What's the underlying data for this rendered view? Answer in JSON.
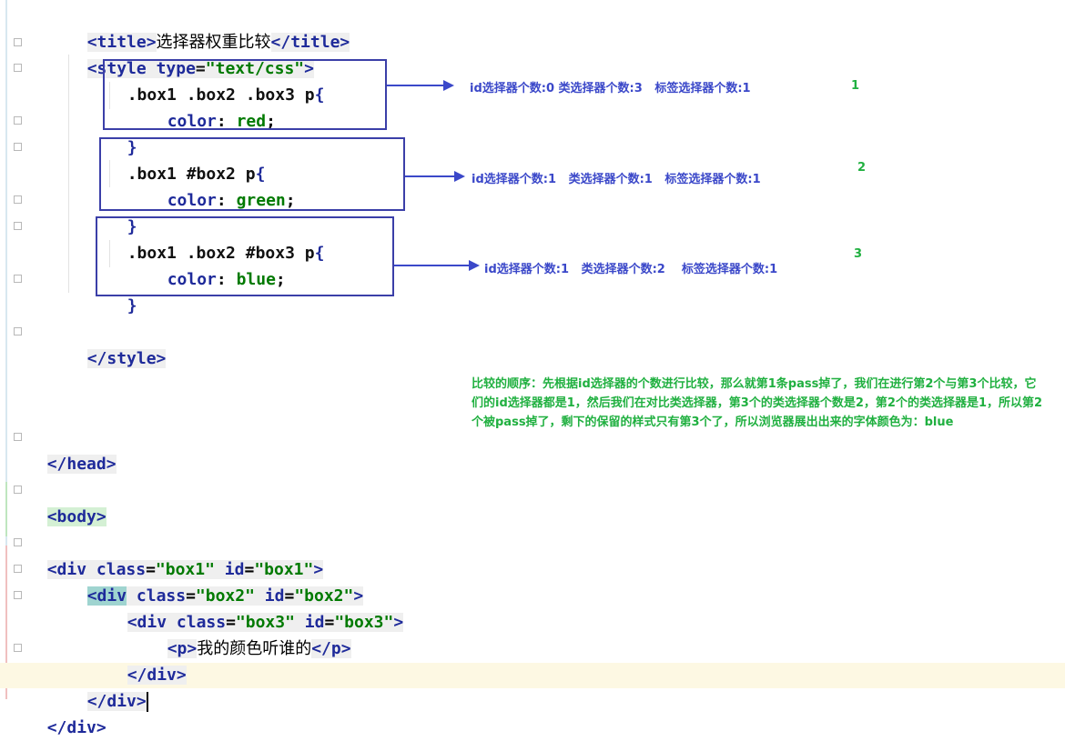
{
  "editor": {
    "lines": {
      "title": {
        "open_tag": "<title>",
        "text": "选择器权重比较",
        "close_tag": "</title>"
      },
      "style_open": {
        "tag_start": "<style",
        "attr": "type",
        "eq": "=",
        "value": "\"text/css\"",
        "tag_end": ">"
      },
      "rule1": {
        "selector": ".box1 .box2 .box3 p",
        "brace_open": "{",
        "property": "color",
        "colon": ": ",
        "value": "red",
        "semi": ";",
        "brace_close": "}"
      },
      "rule2": {
        "selector": ".box1 #box2 p",
        "brace_open": "{",
        "property": "color",
        "colon": ": ",
        "value": "green",
        "semi": ";",
        "brace_close": "}"
      },
      "rule3": {
        "selector": ".box1 .box2 #box3 p",
        "brace_open": "{",
        "property": "color",
        "colon": ": ",
        "value": "blue",
        "semi": ";",
        "brace_close": "}"
      },
      "style_close": "</style>",
      "head_close": "</head>",
      "body_open": "<body>",
      "div1": {
        "tag_start": "<div",
        "class_attr": "class",
        "class_val": "\"box1\"",
        "id_attr": "id",
        "id_val": "\"box1\"",
        "tag_end": ">"
      },
      "div2": {
        "tag_start": "<div",
        "class_attr": "class",
        "class_val": "\"box2\"",
        "id_attr": "id",
        "id_val": "\"box2\"",
        "tag_end": ">"
      },
      "div3": {
        "tag_start": "<div",
        "class_attr": "class",
        "class_val": "\"box3\"",
        "id_attr": "id",
        "id_val": "\"box3\"",
        "tag_end": ">"
      },
      "p_line": {
        "open_tag": "<p>",
        "text": "我的颜色听谁的",
        "close_tag": "</p>"
      },
      "div3_close": "</div>",
      "div2_close": "</div>",
      "div1_close_partial": "</div>"
    }
  },
  "annotations": {
    "note1": "id选择器个数:0 类选择器个数:3   标签选择器个数:1",
    "note2": "id选择器个数:1   类选择器个数:1   标签选择器个数:1",
    "note3": "id选择器个数:1   类选择器个数:2    标签选择器个数:1",
    "num1": "1",
    "num2": "2",
    "num3": "3",
    "explanation": "比较的顺序：先根据id选择器的个数进行比较，那么就第1条pass掉了，我们在进行第2个与第3个比较，它们的id选择器都是1，然后我们在对比类选择器，第3个的类选择器个数是2，第2个的类选择器是1，所以第2个被pass掉了，剩下的保留的样式只有第3个了，所以浏览器展出出来的字体颜色为：blue"
  },
  "colors": {
    "tag": "#1e2a9a",
    "string": "#007a00",
    "annotation_box": "#3b3fa8",
    "annotation_text": "#3b48c9",
    "explanation_text": "#20b040"
  }
}
